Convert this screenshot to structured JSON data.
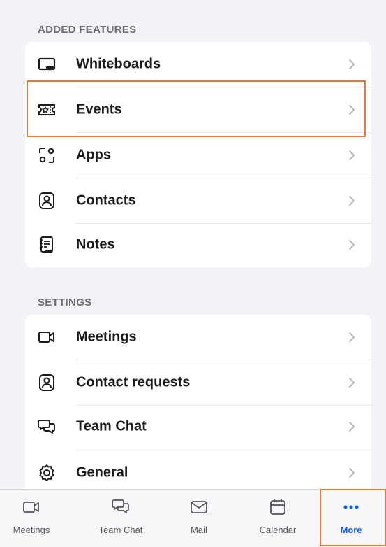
{
  "colors": {
    "accent": "#0e5cff",
    "highlight": "#e07a3f"
  },
  "added_features": {
    "header": "ADDED FEATURES",
    "items": [
      {
        "label": "Whiteboards",
        "icon": "whiteboard-icon"
      },
      {
        "label": "Events",
        "icon": "ticket-icon"
      },
      {
        "label": "Apps",
        "icon": "apps-icon"
      },
      {
        "label": "Contacts",
        "icon": "contact-icon"
      },
      {
        "label": "Notes",
        "icon": "notes-icon"
      }
    ]
  },
  "settings": {
    "header": "SETTINGS",
    "items": [
      {
        "label": "Meetings",
        "icon": "video-camera-icon"
      },
      {
        "label": "Contact requests",
        "icon": "contact-icon"
      },
      {
        "label": "Team Chat",
        "icon": "chat-bubbles-icon"
      },
      {
        "label": "General",
        "icon": "gear-icon"
      }
    ]
  },
  "tabbar": {
    "tabs": [
      {
        "label": "Meetings",
        "icon": "video-camera-icon"
      },
      {
        "label": "Team Chat",
        "icon": "chat-bubbles-icon"
      },
      {
        "label": "Mail",
        "icon": "mail-icon"
      },
      {
        "label": "Calendar",
        "icon": "calendar-icon"
      },
      {
        "label": "More",
        "icon": "more-dots-icon",
        "active": true
      }
    ]
  }
}
